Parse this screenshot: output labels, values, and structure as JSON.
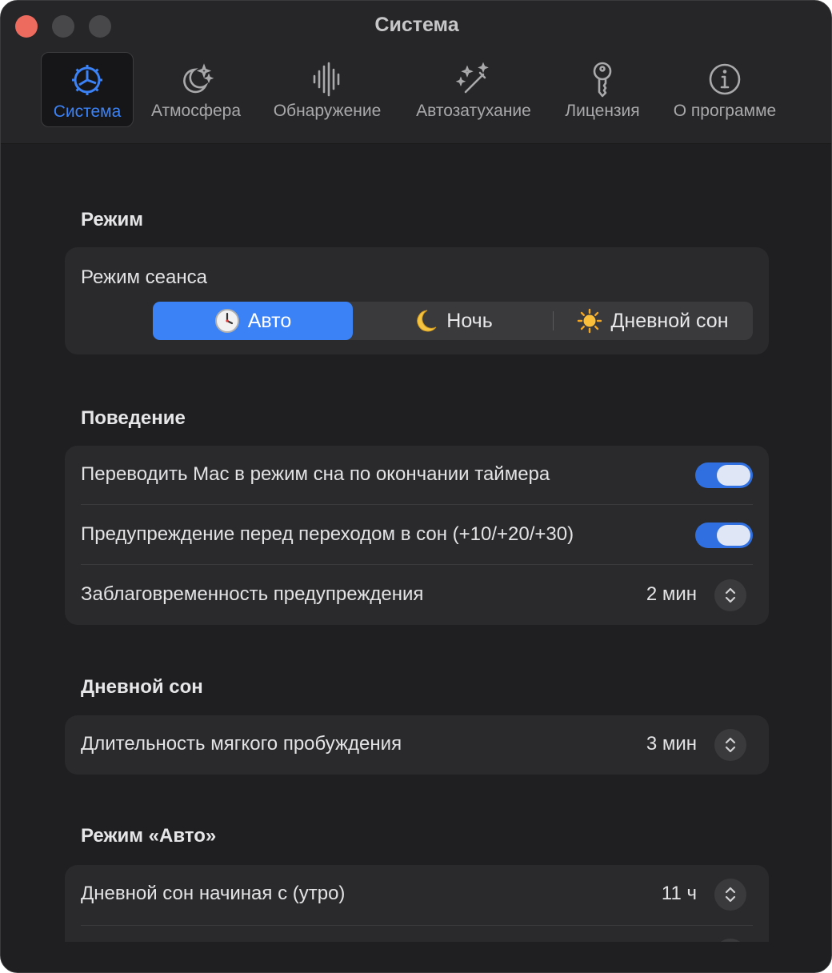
{
  "window": {
    "title": "Система"
  },
  "tabs": [
    {
      "label": "Система",
      "icon": "gear-icon",
      "active": true
    },
    {
      "label": "Атмосфера",
      "icon": "moon-stars-icon",
      "active": false
    },
    {
      "label": "Обнаружение",
      "icon": "waveform-icon",
      "active": false
    },
    {
      "label": "Автозатухание",
      "icon": "magic-wand-icon",
      "active": false
    },
    {
      "label": "Лицензия",
      "icon": "key-icon",
      "active": false
    },
    {
      "label": "О программе",
      "icon": "info-icon",
      "active": false
    }
  ],
  "mode": {
    "title": "Режим",
    "session_label": "Режим сеанса",
    "options": [
      {
        "label": "Авто",
        "icon": "clock-icon",
        "selected": true
      },
      {
        "label": "Ночь",
        "icon": "crescent-moon-icon",
        "selected": false
      },
      {
        "label": "Дневной сон",
        "icon": "sun-icon",
        "selected": false
      }
    ]
  },
  "behavior": {
    "title": "Поведение",
    "sleep_mac_label": "Переводить Mac в режим сна по окончании таймера",
    "sleep_mac_on": true,
    "warning_label": "Предупреждение перед переходом в сон (+10/+20/+30)",
    "warning_on": true,
    "advance_label": "Заблаговременность предупреждения",
    "advance_value": "2 мин"
  },
  "nap": {
    "title": "Дневной сон",
    "wake_label": "Длительность мягкого пробуждения",
    "wake_value": "3 мин"
  },
  "auto": {
    "title": "Режим «Авто»",
    "start_label": "Дневной сон начиная с (утро)",
    "start_value": "11 ч"
  },
  "colors": {
    "accent": "#3b82f6",
    "close": "#ed6a5e",
    "background": "#1f1f21",
    "card": "#2a2a2c"
  }
}
